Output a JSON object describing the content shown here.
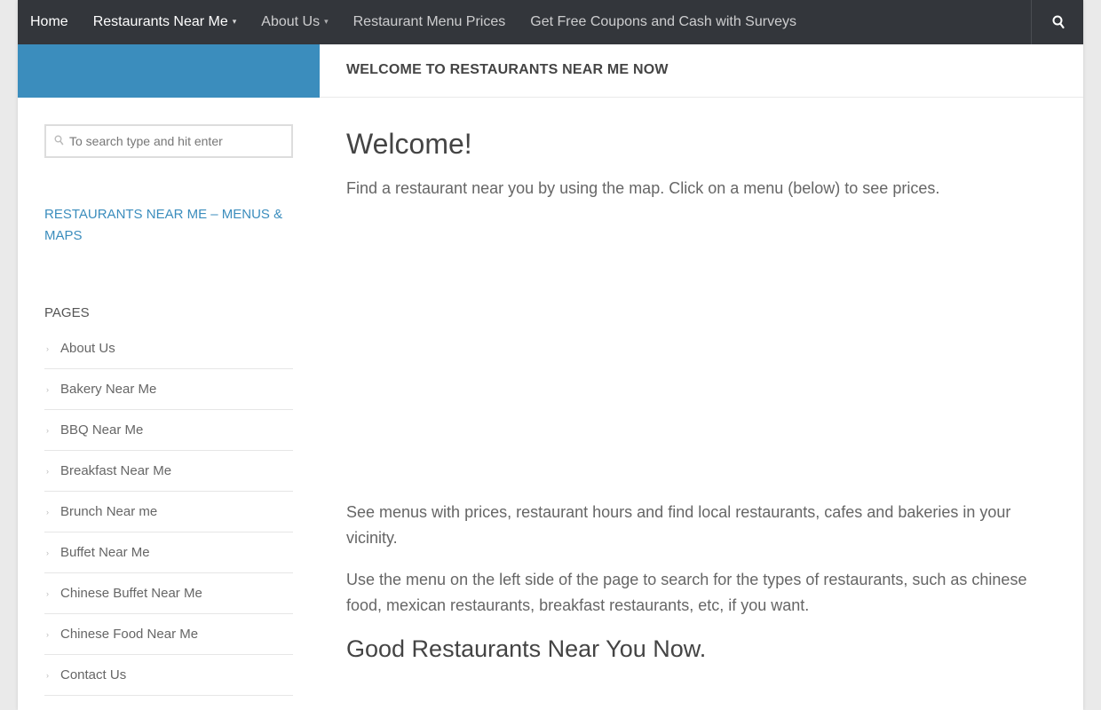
{
  "nav": {
    "items": [
      {
        "label": "Home",
        "caret": ""
      },
      {
        "label": "Restaurants Near Me",
        "caret": "▾"
      },
      {
        "label": "About Us",
        "caret": "▾"
      },
      {
        "label": "Restaurant Menu Prices",
        "caret": ""
      },
      {
        "label": "Get Free Coupons and Cash with Surveys",
        "caret": ""
      }
    ],
    "search_icon": "search-icon"
  },
  "header": {
    "title": "WELCOME TO RESTAURANTS NEAR ME NOW"
  },
  "sidebar": {
    "search": {
      "placeholder": "To search type and hit enter"
    },
    "widget_title": "RESTAURANTS NEAR ME – MENUS & MAPS",
    "pages_title": "PAGES",
    "pages": [
      "About Us",
      "Bakery Near Me",
      "BBQ Near Me",
      "Breakfast Near Me",
      "Brunch Near me",
      "Buffet Near Me",
      "Chinese Buffet Near Me",
      "Chinese Food Near Me",
      "Contact Us"
    ]
  },
  "main": {
    "heading": "Welcome!",
    "intro": "Find a restaurant near you by using the map. Click on a menu (below) to see prices.",
    "para1": "See menus with prices, restaurant hours and find local restaurants, cafes and bakeries in your vicinity.",
    "para2": "Use the menu on the left side of the page to search for the types of restaurants, such as chinese food, mexican restaurants, breakfast restaurants, etc, if you want.",
    "subheading": "Good Restaurants Near You Now."
  },
  "colors": {
    "nav_bg": "#33363b",
    "accent": "#3b8dbd"
  }
}
